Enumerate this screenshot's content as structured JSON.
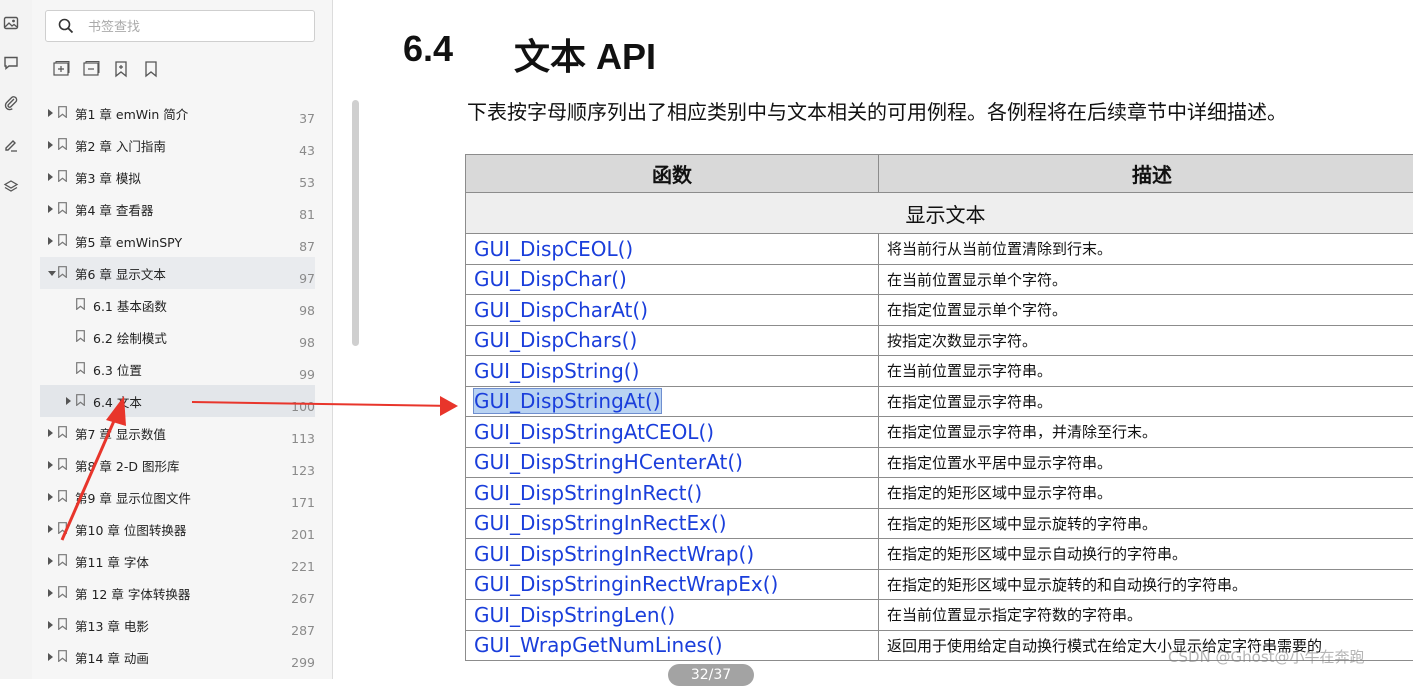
{
  "sidebar": {
    "search_placeholder": "书签查找",
    "items": [
      {
        "label": "第1 章 emWin 简介",
        "page": "37",
        "level": 0,
        "state": "collapsed"
      },
      {
        "label": "第2 章 入门指南",
        "page": "43",
        "level": 0,
        "state": "collapsed"
      },
      {
        "label": "第3 章 模拟",
        "page": "53",
        "level": 0,
        "state": "collapsed"
      },
      {
        "label": "第4 章 查看器",
        "page": "81",
        "level": 0,
        "state": "collapsed"
      },
      {
        "label": "第5 章 emWinSPY",
        "page": "87",
        "level": 0,
        "state": "collapsed"
      },
      {
        "label": "第6 章 显示文本",
        "page": "97",
        "level": 0,
        "state": "expanded"
      },
      {
        "label": "6.1 基本函数",
        "page": "98",
        "level": 1,
        "state": "leaf"
      },
      {
        "label": "6.2 绘制模式",
        "page": "98",
        "level": 1,
        "state": "leaf"
      },
      {
        "label": "6.3 位置",
        "page": "99",
        "level": 1,
        "state": "leaf"
      },
      {
        "label": "6.4 文本",
        "page": "100",
        "level": 1,
        "state": "selected"
      },
      {
        "label": "第7 章 显示数值",
        "page": "113",
        "level": 0,
        "state": "collapsed"
      },
      {
        "label": "第8 章 2-D 图形库",
        "page": "123",
        "level": 0,
        "state": "collapsed"
      },
      {
        "label": "第9 章 显示位图文件",
        "page": "171",
        "level": 0,
        "state": "collapsed"
      },
      {
        "label": "第10 章 位图转换器",
        "page": "201",
        "level": 0,
        "state": "collapsed"
      },
      {
        "label": "第11 章 字体",
        "page": "221",
        "level": 0,
        "state": "collapsed"
      },
      {
        "label": "第 12 章 字体转换器",
        "page": "267",
        "level": 0,
        "state": "collapsed"
      },
      {
        "label": "第13 章 电影",
        "page": "287",
        "level": 0,
        "state": "collapsed"
      },
      {
        "label": "第14 章 动画",
        "page": "299",
        "level": 0,
        "state": "collapsed"
      }
    ]
  },
  "document": {
    "section_number": "6.4",
    "section_title": "文本 API",
    "intro": "下表按字母顺序列出了相应类别中与文本相关的可用例程。各例程将在后续章节中详细描述。",
    "table": {
      "col_function": "函数",
      "col_description": "描述",
      "group": "显示文本",
      "rows": [
        {
          "fn": "GUI_DispCEOL()",
          "desc": "将当前行从当前位置清除到行末。"
        },
        {
          "fn": "GUI_DispChar()",
          "desc": "在当前位置显示单个字符。"
        },
        {
          "fn": "GUI_DispCharAt()",
          "desc": "在指定位置显示单个字符。"
        },
        {
          "fn": "GUI_DispChars()",
          "desc": "按指定次数显示字符。"
        },
        {
          "fn": "GUI_DispString()",
          "desc": "在当前位置显示字符串。"
        },
        {
          "fn": "GUI_DispStringAt()",
          "desc": "在指定位置显示字符串。",
          "highlight": true
        },
        {
          "fn": "GUI_DispStringAtCEOL()",
          "desc": "在指定位置显示字符串，并清除至行末。"
        },
        {
          "fn": "GUI_DispStringHCenterAt()",
          "desc": "在指定位置水平居中显示字符串。"
        },
        {
          "fn": "GUI_DispStringInRect()",
          "desc": "在指定的矩形区域中显示字符串。"
        },
        {
          "fn": "GUI_DispStringInRectEx()",
          "desc": "在指定的矩形区域中显示旋转的字符串。"
        },
        {
          "fn": "GUI_DispStringInRectWrap()",
          "desc": "在指定的矩形区域中显示自动换行的字符串。"
        },
        {
          "fn": "GUI_DispStringinRectWrapEx()",
          "desc": "在指定的矩形区域中显示旋转的和自动换行的字符串。"
        },
        {
          "fn": "GUI_DispStringLen()",
          "desc": "在当前位置显示指定字符数的字符串。"
        },
        {
          "fn": "GUI_WrapGetNumLines()",
          "desc": "返回用于使用给定自动换行模式在给定大小显示给定字符串需要的"
        }
      ]
    }
  },
  "page_indicator": "32/37",
  "watermark": "CSDN @Ghost@小牛在奔跑",
  "colors": {
    "link": "#1a3edb",
    "arrow": "#e8352b",
    "highlight": "#b9d3f2"
  },
  "icons": [
    "image-icon",
    "comment-icon",
    "attachment-icon",
    "signature-icon",
    "layers-icon",
    "search-icon",
    "expand-all-icon",
    "collapse-all-icon",
    "add-bookmark-icon",
    "bookmark-outline-icon",
    "bookmark-icon",
    "annotation-arrow"
  ]
}
